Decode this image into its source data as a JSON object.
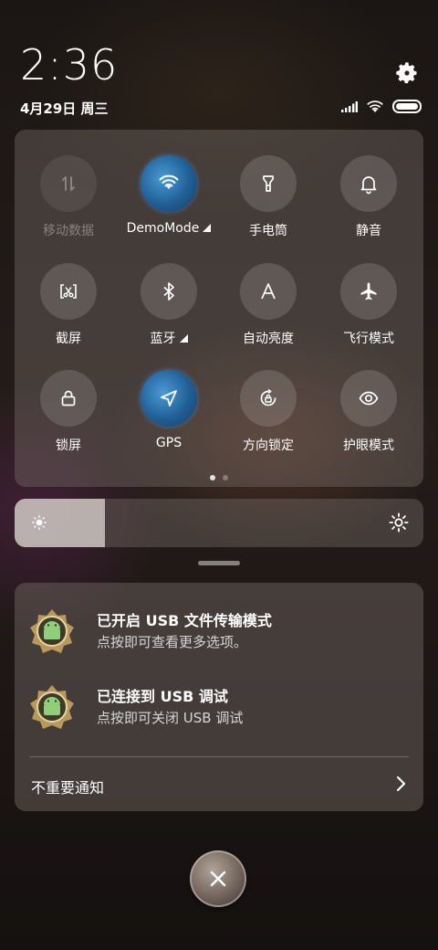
{
  "status": {
    "time": "2:36",
    "date": "4月29日 周三",
    "icons": [
      "signal-icon",
      "wifi-icon",
      "battery-icon"
    ]
  },
  "quick_settings": {
    "tiles": [
      {
        "label": "移动数据",
        "icon": "mobile-data-icon",
        "state": "disabled"
      },
      {
        "label": "DemoMode",
        "icon": "wifi-icon",
        "state": "on",
        "expandable": true
      },
      {
        "label": "手电筒",
        "icon": "flashlight-icon",
        "state": "off"
      },
      {
        "label": "静音",
        "icon": "bell-icon",
        "state": "off"
      },
      {
        "label": "截屏",
        "icon": "screenshot-icon",
        "state": "off"
      },
      {
        "label": "蓝牙",
        "icon": "bluetooth-icon",
        "state": "off",
        "expandable": true
      },
      {
        "label": "自动亮度",
        "icon": "auto-brightness-icon",
        "state": "off"
      },
      {
        "label": "飞行模式",
        "icon": "airplane-icon",
        "state": "off"
      },
      {
        "label": "锁屏",
        "icon": "lock-icon",
        "state": "off"
      },
      {
        "label": "GPS",
        "icon": "location-icon",
        "state": "on"
      },
      {
        "label": "方向锁定",
        "icon": "rotation-lock-icon",
        "state": "off"
      },
      {
        "label": "护眼模式",
        "icon": "eye-icon",
        "state": "off"
      }
    ],
    "page_count": 2,
    "current_page": 1
  },
  "brightness": {
    "level_percent": 22
  },
  "notifications": {
    "items": [
      {
        "title": "已开启 USB 文件传输模式",
        "subtitle": "点按即可查看更多选项。",
        "icon": "android-badge-icon"
      },
      {
        "title": "已连接到 USB 调试",
        "subtitle": "点按即可关闭 USB 调试",
        "icon": "android-badge-icon"
      }
    ],
    "unimportant_label": "不重要通知"
  },
  "colors": {
    "active_tile": "#2a73b5"
  }
}
